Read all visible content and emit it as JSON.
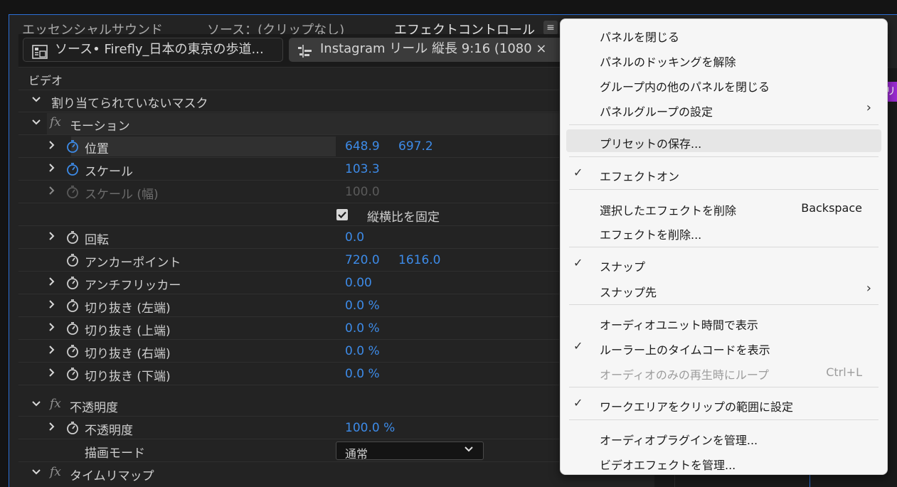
{
  "tabs": {
    "essential_sound": "エッセンシャルサウンド",
    "source": "ソース：(クリップなし)",
    "effect_controls": "エフェクトコントロール",
    "menu_icon": "hamburger-icon"
  },
  "clips": {
    "source_clip": "ソース• Firefly_日本の東京の歩道...",
    "sequence_clip": "Instagram リール 縦長 9:16 (1080 ×"
  },
  "section": {
    "video": "ビデオ"
  },
  "rows": {
    "mask": "割り当てられていないマスク",
    "motion": "モーション",
    "position": {
      "label": "位置",
      "x": "648.9",
      "y": "697.2"
    },
    "scale": {
      "label": "スケール",
      "value": "103.3"
    },
    "scale_width": {
      "label": "スケール (幅)",
      "value": "100.0"
    },
    "uniform_scale": {
      "label": "縦横比を固定"
    },
    "rotation": {
      "label": "回転",
      "value": "0.0"
    },
    "anchor": {
      "label": "アンカーポイント",
      "x": "720.0",
      "y": "1616.0"
    },
    "antiflicker": {
      "label": "アンチフリッカー",
      "value": "0.00"
    },
    "crop_left": {
      "label": "切り抜き (左端)",
      "value": "0.0 %"
    },
    "crop_top": {
      "label": "切り抜き (上端)",
      "value": "0.0 %"
    },
    "crop_right": {
      "label": "切り抜き (右端)",
      "value": "0.0 %"
    },
    "crop_bottom": {
      "label": "切り抜き (下端)",
      "value": "0.0 %"
    },
    "opacity_group": "不透明度",
    "opacity": {
      "label": "不透明度",
      "value": "100.0 %"
    },
    "blend_mode": {
      "label": "描画モード",
      "value": "通常"
    },
    "time_remap": "タイムリマップ"
  },
  "right_edge_label": "リ",
  "menu": {
    "close_panel": "パネルを閉じる",
    "undock_panel": "パネルのドッキングを解除",
    "close_other_panels": "グループ内の他のパネルを閉じる",
    "panel_group_settings": "パネルグループの設定",
    "save_preset": "プリセットの保存...",
    "effects_on": "エフェクトオン",
    "delete_selected_effect": "選択したエフェクトを削除",
    "delete_selected_shortcut": "Backspace",
    "delete_effects": "エフェクトを削除...",
    "snap": "スナップ",
    "snap_to": "スナップ先",
    "show_audio_time_units": "オーディオユニット時間で表示",
    "show_timecode_on_ruler": "ルーラー上のタイムコードを表示",
    "loop_audio_only": "オーディオのみの再生時にループ",
    "loop_audio_shortcut": "Ctrl+L",
    "set_work_area": "ワークエリアをクリップの範囲に設定",
    "manage_audio_plugins": "オーディオプラグインを管理...",
    "manage_video_effects": "ビデオエフェクトを管理..."
  },
  "colors": {
    "accent_blue": "#3d8be8",
    "panel_border": "#2c6fd6",
    "menu_bg": "#f6f6f6",
    "purple_label": "#9b2bd1"
  }
}
